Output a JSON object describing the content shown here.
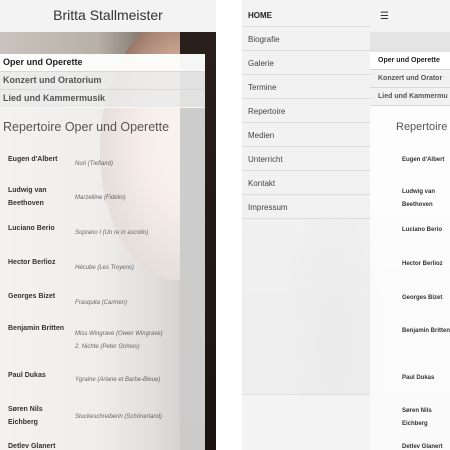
{
  "site_title": "Britta Stallmeister",
  "left_nav": [
    {
      "label": "Oper und Operette",
      "active": true
    },
    {
      "label": "Konzert und Oratorium",
      "active": false
    },
    {
      "label": "Lied und Kammermusik",
      "active": false
    }
  ],
  "content_title": "Repertoire Oper und Operette",
  "repertoire": [
    {
      "composer": "Eugen d'Albert",
      "role": "Nuri (Tiefland)"
    },
    {
      "composer": "Ludwig van Beethoven",
      "role": "Marzelline (Fidelio)"
    },
    {
      "composer": "Luciano Berio",
      "role": "Soprano I (Un re in ascolto)"
    },
    {
      "composer": "Hector Berlioz",
      "role": "Hécube (Les Troyens)"
    },
    {
      "composer": "Georges Bizet",
      "role": "Frasquita (Carmen)"
    },
    {
      "composer": "Benjamin Britten",
      "role": "Miss Wingrave (Owen Wingrave)",
      "role2": "2. Nichte (Peter Grimes)"
    },
    {
      "composer": "Paul Dukas",
      "role": "Ygraine (Ariane et Barbe-Bleue)"
    },
    {
      "composer": "Søren Nils Eichberg",
      "role": "Stuckeschreiberin (Schönerland)"
    },
    {
      "composer": "Detlev Glanert",
      "role": ""
    }
  ],
  "side_menu": [
    "HOME",
    "Biografie",
    "Galerie",
    "Termine",
    "Repertoire",
    "Medien",
    "Unterricht",
    "Kontakt",
    "Impressum"
  ],
  "hamburger_icon": "☰",
  "right_nav": [
    "Oper und Operette",
    "Konzert und Orator",
    "Lied und Kammermu"
  ],
  "right_content_title": "Repertoire Op",
  "right_composers": [
    "Eugen d'Albert",
    "Ludwig van Beethoven",
    "Luciano Berio",
    "Hector Berlioz",
    "Georges Bizet",
    "Benjamin Britten",
    "Paul Dukas",
    "Søren Nils Eichberg",
    "Detlev Glanert"
  ]
}
